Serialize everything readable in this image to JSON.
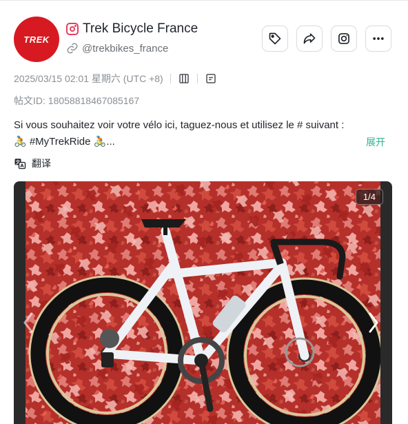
{
  "account": {
    "avatar_text": "TREK",
    "display_name": "Trek Bicycle France",
    "handle": "@trekbikes_france",
    "platform_icon": "instagram-icon"
  },
  "actions": [
    {
      "name": "tag-button",
      "icon": "tag-icon"
    },
    {
      "name": "share-button",
      "icon": "share-icon"
    },
    {
      "name": "instagram-button",
      "icon": "instagram-icon"
    },
    {
      "name": "more-button",
      "icon": "more-icon"
    }
  ],
  "meta": {
    "datetime": "2025/03/15 02:01 星期六 (UTC +8)",
    "post_id_label": "帖文ID: 1805881846708516​7"
  },
  "post": {
    "caption_line1": "Si vous souhaitez voir votre vélo ici, taguez-nous et utilisez le # suivant :",
    "caption_line2": "🚴 #MyTrekRide 🚴...",
    "expand_label": "展开",
    "translate_label": "翻译"
  },
  "media": {
    "counter": "1/4",
    "description_icon": "bike-photo"
  },
  "colors": {
    "brand": "#d71a21",
    "accent": "#2fb48f",
    "muted": "#8a8f94"
  }
}
